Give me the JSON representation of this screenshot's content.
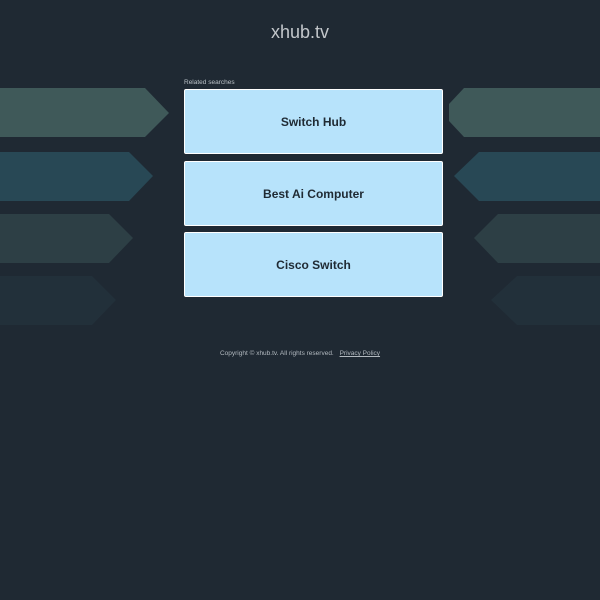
{
  "header": {
    "title": "xhub.tv"
  },
  "related": {
    "label": "Related searches",
    "items": [
      {
        "label": "Switch Hub"
      },
      {
        "label": "Best Ai Computer"
      },
      {
        "label": "Cisco Switch"
      }
    ]
  },
  "footer": {
    "copyright": "Copyright © xhub.tv.  All rights reserved.",
    "privacy_link": "Privacy Policy"
  },
  "colors": {
    "background": "#1f2933",
    "box_fill": "#b7e3fb",
    "arrow_1": "#3f5959",
    "arrow_2": "#284855",
    "arrow_3": "#2d3f45",
    "arrow_4": "#22303a"
  }
}
